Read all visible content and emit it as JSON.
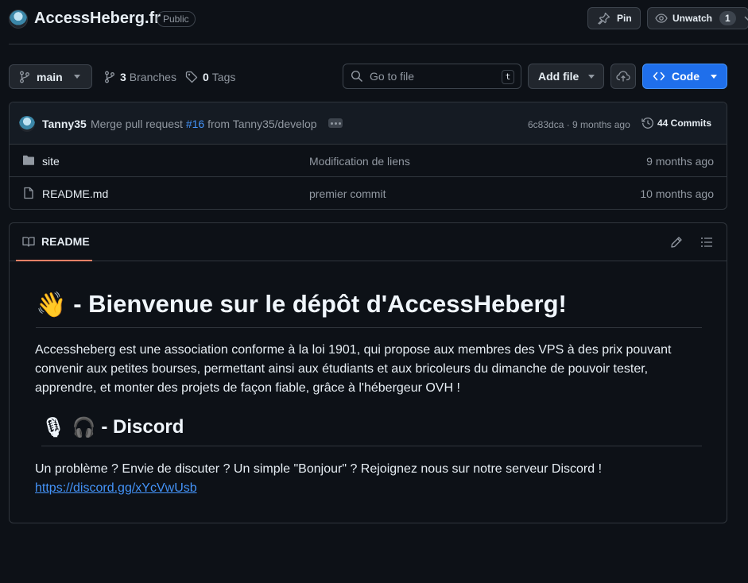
{
  "repo": {
    "name": "AccessHeberg.fr",
    "visibility": "Public"
  },
  "header": {
    "pin_label": "Pin",
    "unwatch_label": "Unwatch",
    "watch_count": "1"
  },
  "toolbar": {
    "branch": "main",
    "branches_count": "3",
    "branches_label": "Branches",
    "tags_count": "0",
    "tags_label": "Tags",
    "goto_placeholder": "Go to file",
    "goto_shortcut": "t",
    "add_file_label": "Add file",
    "code_label": "Code"
  },
  "latest_commit": {
    "author": "Tanny35",
    "message_prefix": "Merge pull request",
    "pr_ref": "#16",
    "message_suffix": "from Tanny35/develop",
    "sha_time": "6c83dca · 9 months ago",
    "commits_label": "44 Commits"
  },
  "files": [
    {
      "name": "site",
      "type": "folder",
      "commit": "Modification de liens",
      "date": "9 months ago"
    },
    {
      "name": "README.md",
      "type": "file",
      "commit": "premier commit",
      "date": "10 months ago"
    }
  ],
  "readme": {
    "tab_label": "README",
    "h1_emoji": "👋",
    "h1_text": " - Bienvenue sur le dépôt d'AccessHeberg!",
    "p1": "Accessheberg est une association conforme à la loi 1901, qui propose aux membres des VPS à des prix pouvant convenir aux petites bourses, permettant ainsi aux étudiants et aux bricoleurs du dimanche de pouvoir tester, apprendre, et monter des projets de façon fiable, grâce à l'hébergeur OVH !",
    "h2_emoji": "🎙 🎧",
    "h2_text": " - Discord",
    "p2": "Un problème ? Envie de discuter ? Un simple \"Bonjour\" ? Rejoignez nous sur notre serveur Discord !",
    "link": "https://discord.gg/xYcVwUsb"
  },
  "colors": {
    "background": "#0d1117",
    "border": "#30363d",
    "accent_blue": "#1f6feb",
    "link": "#4493f8",
    "tab_underline": "#f78166"
  }
}
